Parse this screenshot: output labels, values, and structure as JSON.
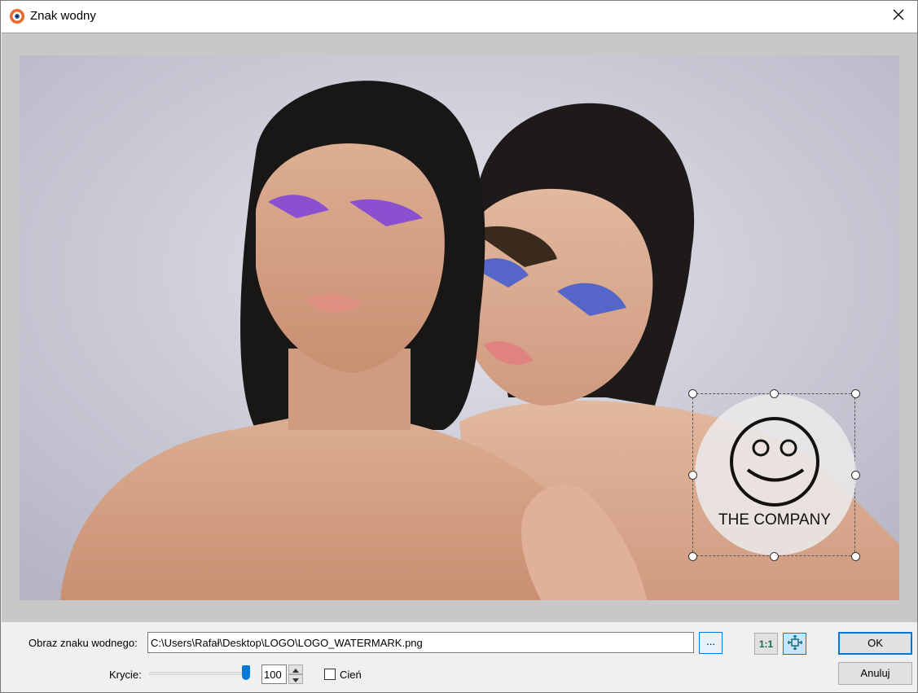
{
  "window": {
    "title": "Znak wodny",
    "close_icon": "close-icon",
    "app_icon": "app-logo-icon"
  },
  "watermark": {
    "text": "THE COMPANY",
    "icon": "smiley-icon"
  },
  "controls": {
    "path_label": "Obraz znaku wodnego:",
    "path_value": "C:\\Users\\Rafał\\Desktop\\LOGO\\LOGO_WATERMARK.png",
    "browse_label": "...",
    "actual_size_label": "1:1",
    "fit_icon": "move-arrows-icon",
    "opacity_label": "Krycie:",
    "opacity_value": "100",
    "shadow_label": "Cień",
    "ok_label": "OK",
    "cancel_label": "Anuluj"
  },
  "colors": {
    "accent": "#0078d7",
    "preview_bg": "#c8c8c8"
  }
}
